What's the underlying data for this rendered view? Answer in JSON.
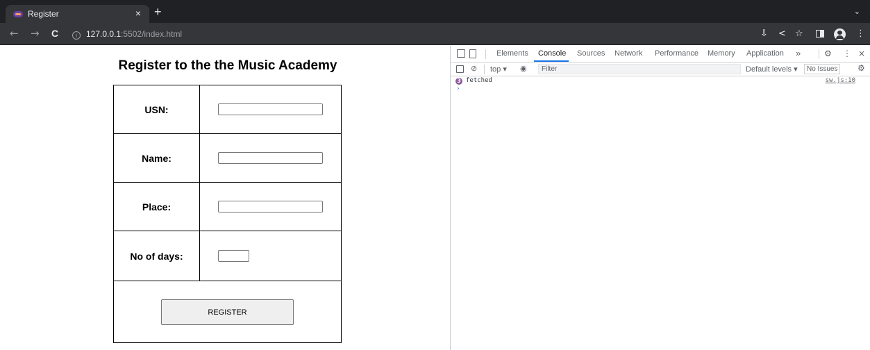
{
  "browser": {
    "tab_title": "Register",
    "tab_close": "×",
    "new_tab": "+",
    "tab_search": "⌄",
    "url_host": "127.0.0.1",
    "url_rest": ":5502/index.html",
    "info_glyph": "i",
    "back": "←",
    "forward": "→",
    "reload": "C",
    "install_icon": "⇩",
    "share_icon": "<",
    "star_icon": "☆",
    "menu_icon": "⋮"
  },
  "page": {
    "heading": "Register to the the Music Academy",
    "form": {
      "fields": [
        {
          "label": "USN:",
          "value": ""
        },
        {
          "label": "Name:",
          "value": ""
        },
        {
          "label": "Place:",
          "value": ""
        },
        {
          "label": "No of days:",
          "value": ""
        }
      ],
      "submit_label": "REGISTER"
    }
  },
  "devtools": {
    "tabs": [
      "Elements",
      "Console",
      "Sources",
      "Network",
      "Performance",
      "Memory",
      "Application"
    ],
    "active_tab": "Console",
    "more_tabs": "»",
    "settings_glyph": "⚙",
    "menu_glyph": "⋮",
    "close_glyph": "×",
    "context": "top ▾",
    "filter_placeholder": "Filter",
    "levels": "Default levels ▾",
    "issues": "No Issues",
    "console_logs": [
      {
        "count": "3",
        "message": "fetched",
        "source": "sw.js:10"
      }
    ],
    "prompt": "›"
  }
}
